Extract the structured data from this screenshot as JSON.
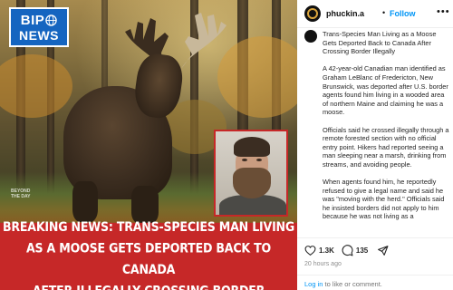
{
  "image": {
    "logo": {
      "top": "BIP",
      "bottom": "NEWS"
    },
    "watermark": "BEYOND THE DAY",
    "banner_lines": [
      "BREAKING NEWS: TRANS-SPECIES MAN LIVING",
      "AS A MOOSE GETS DEPORTED BACK TO CANADA",
      "AFTER ILLEGALLY CROSSING BORDER"
    ]
  },
  "post": {
    "username": "phuckin.a",
    "separator": "•",
    "follow_label": "Follow",
    "more_icon": "more-dots-icon",
    "caption_paragraphs": [
      "Trans-Species Man Living as a Moose Gets Deported Back to Canada After Crossing Border Illegally",
      "A 42-year-old Canadian man identified as Graham LeBlanc of Fredericton, New Brunswick, was deported after U.S. border agents found him living in a wooded area of northern Maine and claiming he was a moose.",
      "Officials said he crossed illegally through a remote forested section with no official entry point. Hikers had reported seeing a man sleeping near a marsh, drinking from streams, and avoiding people.",
      "When agents found him, he reportedly refused to give a legal name and said he was \"moving with the herd.\" Officials said he insisted borders did not apply to him because he was not living as a"
    ],
    "likes": "1.3K",
    "comments": "135",
    "timestamp": "20 hours ago",
    "login_link": "Log in",
    "login_suffix": " to like or comment."
  },
  "colors": {
    "banner": "#c62828",
    "logo_blue": "#1565c0",
    "follow_blue": "#0095f6"
  }
}
